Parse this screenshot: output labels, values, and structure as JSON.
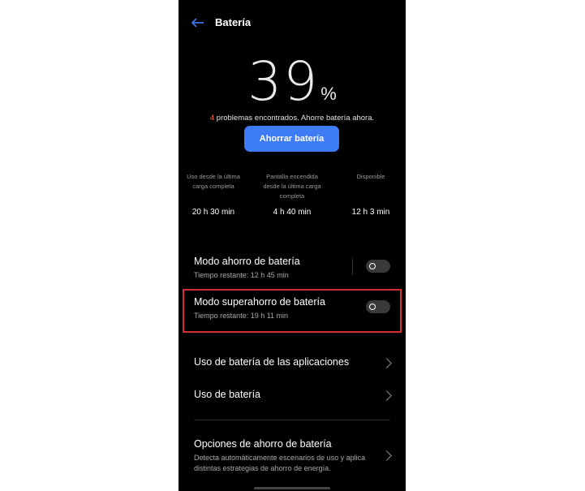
{
  "header": {
    "title": "Batería"
  },
  "battery": {
    "percent": "39",
    "percent_sign": "%"
  },
  "problems": {
    "count": "4",
    "text": " problemas encontrados. Ahorre batería ahora."
  },
  "save_button": {
    "label": "Ahorrar batería"
  },
  "stats": [
    {
      "label_lines": [
        "Uso desde la última",
        "carga completa"
      ],
      "value": "20 h 30 min"
    },
    {
      "label_lines": [
        "Pantalla encendida",
        "desde la última carga",
        "completa"
      ],
      "value": "4 h 40 min"
    },
    {
      "label_lines": [
        "Disponible"
      ],
      "value": "12 h 3 min"
    }
  ],
  "settings": {
    "saver": {
      "title": "Modo ahorro de batería",
      "subtitle": "Tiempo restante:  12 h 45 min",
      "enabled": false
    },
    "super_saver": {
      "title": "Modo superahorro de batería",
      "subtitle": "Tiempo restante:  19 h 11 min",
      "enabled": false
    },
    "app_usage": {
      "title": "Uso de batería de las aplicaciones"
    },
    "usage": {
      "title": "Uso de batería"
    },
    "options": {
      "title": "Opciones de ahorro de batería",
      "description": "Detecta automáticamente escenarios de uso y aplica distintas estrategias de ahorro de energía."
    }
  },
  "colors": {
    "accent": "#3d7cf5",
    "warning": "#ff5a3c",
    "highlight": "#d62d35",
    "background": "#000000"
  },
  "icons": {
    "back": "back-arrow-icon",
    "chevron": "chevron-right-icon"
  }
}
